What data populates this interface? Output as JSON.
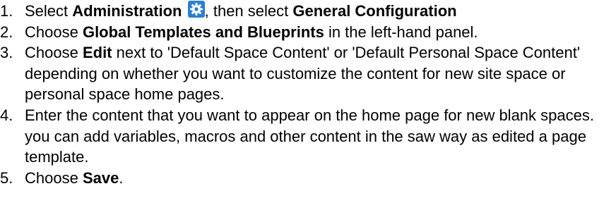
{
  "steps": [
    {
      "number": "1.",
      "parts": {
        "t1": "Select ",
        "b1": "Administration",
        "icon": "gear-icon",
        "t2": ", then select ",
        "b2": "General Configuration"
      }
    },
    {
      "number": "2.",
      "parts": {
        "t1": "Choose ",
        "b1": "Global Templates and Blueprints",
        "t2": " in the left-hand panel."
      }
    },
    {
      "number": "3.",
      "parts": {
        "t1": "Choose ",
        "b1": "Edit",
        "t2": " next to 'Default Space Content' or 'Default Personal Space Content' depending on whether you want to customize the content for new site space or personal space home pages."
      }
    },
    {
      "number": "4.",
      "parts": {
        "t1": "Enter the content that you want to appear on the home page for new blank spaces. you can add variables, macros and other content in the saw way as edited a page template."
      }
    },
    {
      "number": "5.",
      "parts": {
        "t1": "Choose ",
        "b1": "Save",
        "t2": "."
      }
    }
  ],
  "colors": {
    "gear_background": "#2a7fd4",
    "gear_foreground": "#ffffff"
  }
}
